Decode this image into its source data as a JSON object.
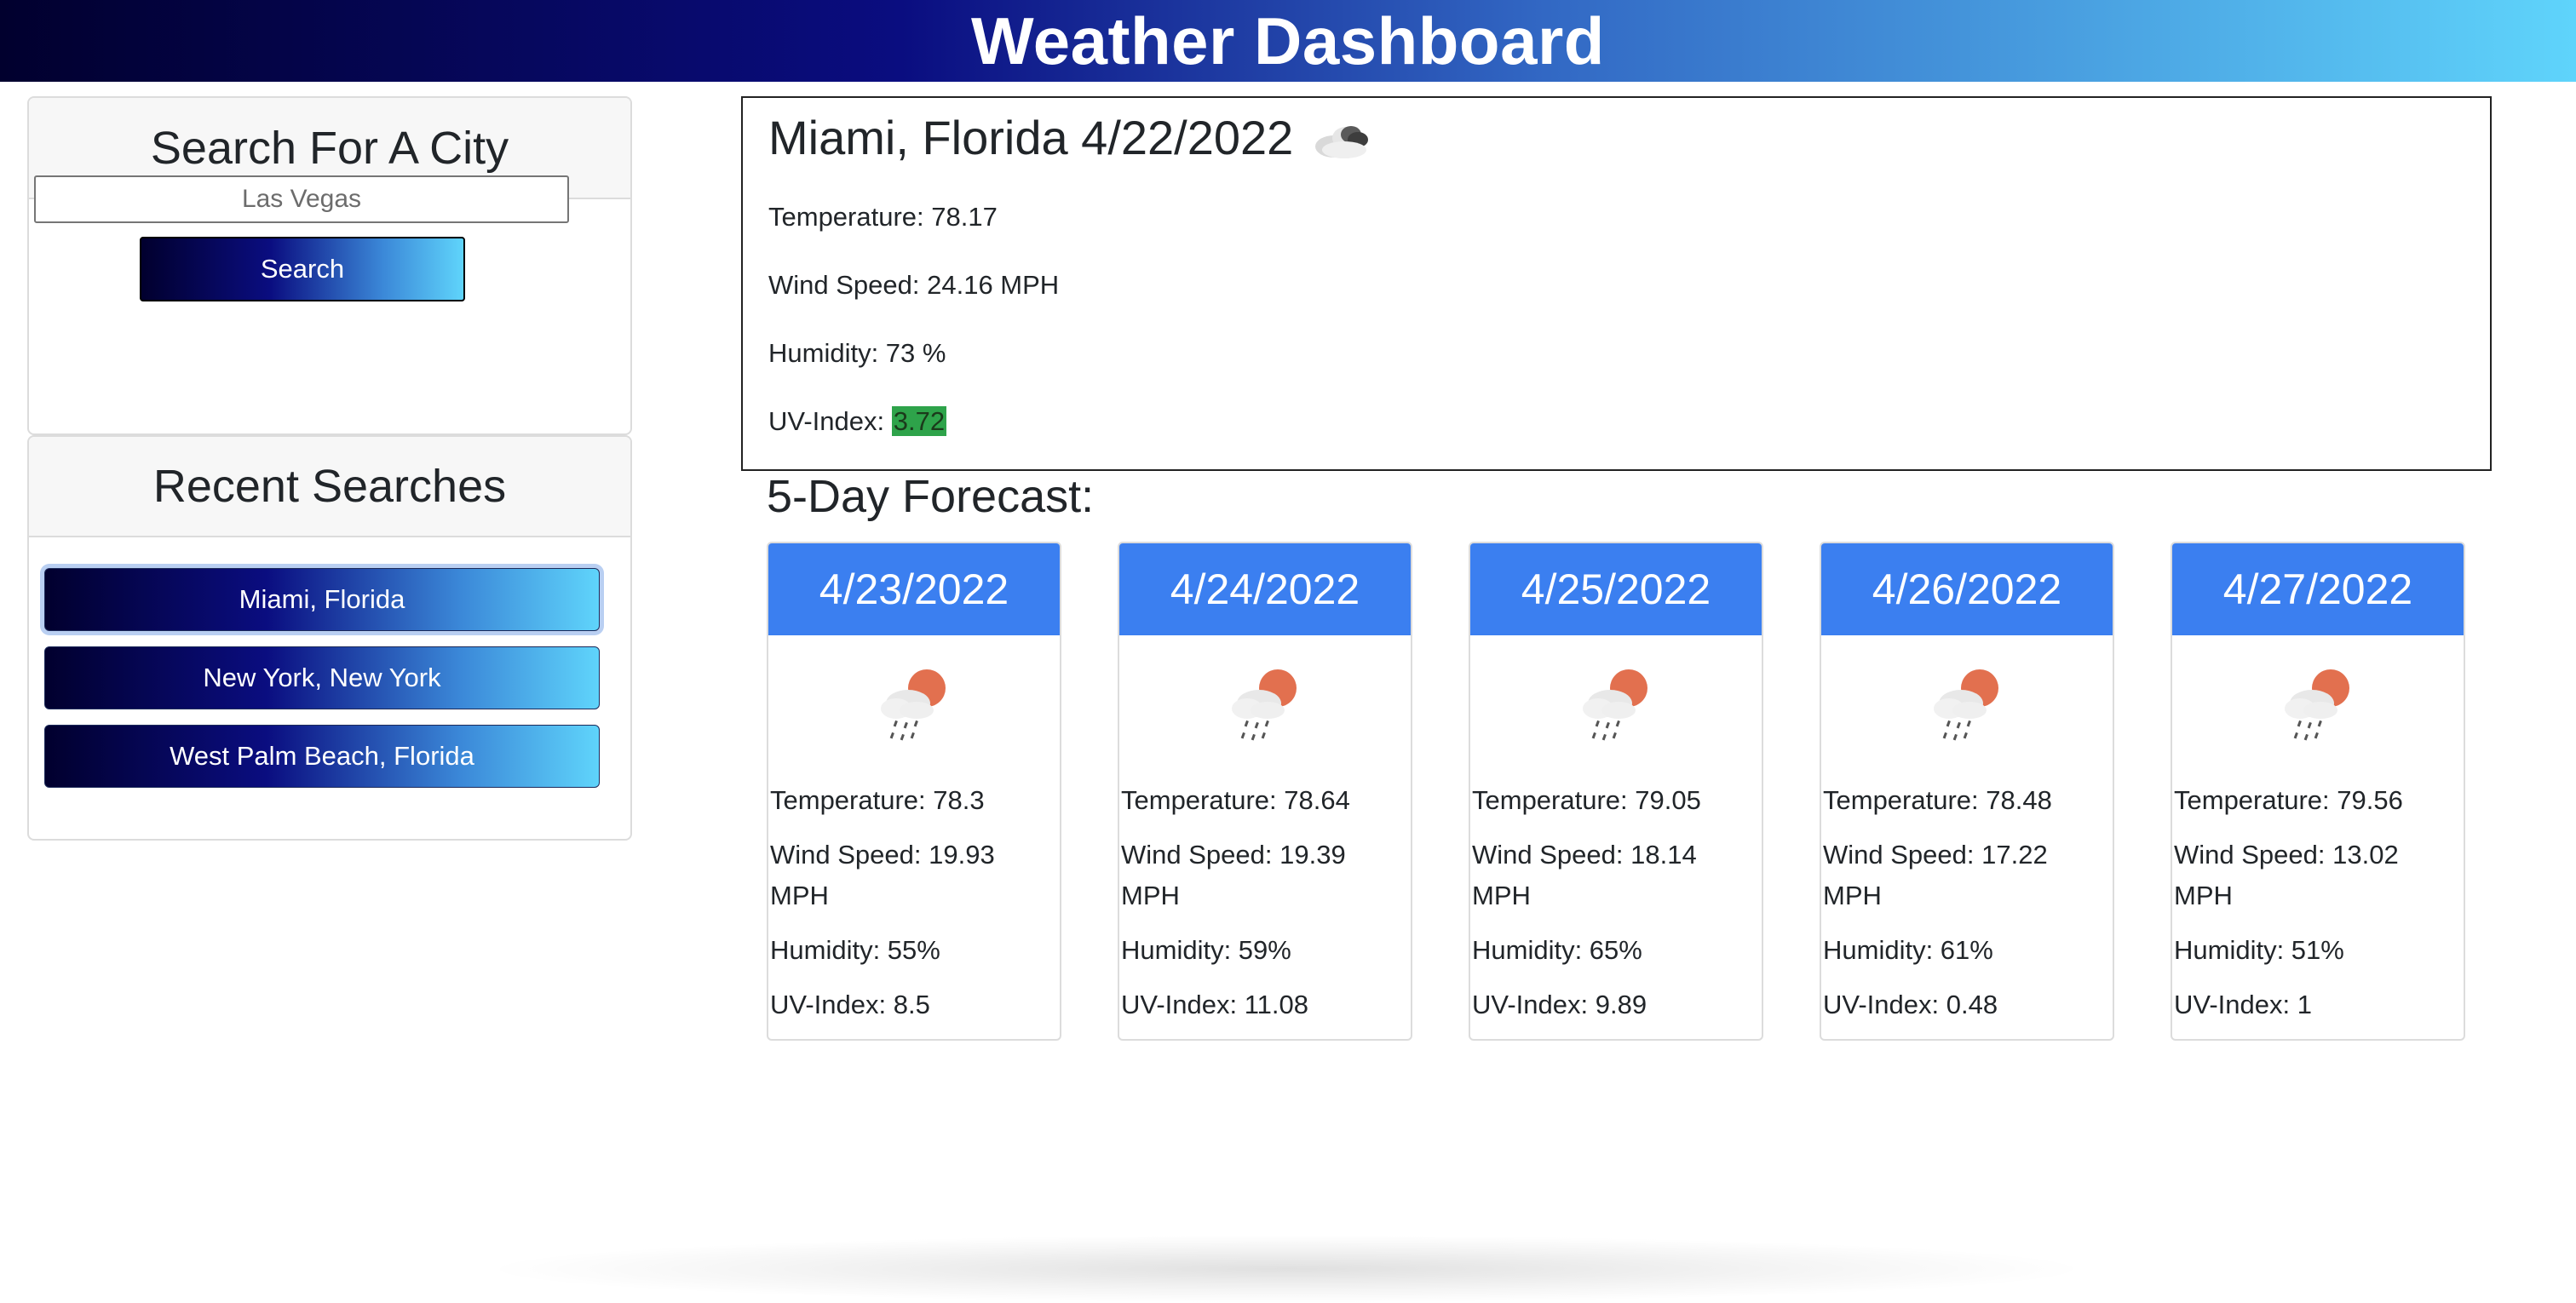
{
  "header": {
    "title": "Weather Dashboard"
  },
  "search": {
    "heading": "Search For A City",
    "placeholder": "Las Vegas",
    "button_label": "Search"
  },
  "recent": {
    "heading": "Recent Searches",
    "items": [
      {
        "label": "Miami, Florida"
      },
      {
        "label": "New York, New York"
      },
      {
        "label": "West Palm Beach, Florida"
      }
    ]
  },
  "current": {
    "title": "Miami, Florida 4/22/2022",
    "icon": "broken-clouds-icon",
    "temperature": "Temperature: 78.17",
    "wind": "Wind Speed: 24.16 MPH",
    "humidity": "Humidity: 73 %",
    "uv_label": "UV-Index: ",
    "uv_value": "3.72",
    "uv_color": "#2ea34a"
  },
  "forecast": {
    "heading": "5-Day Forecast:",
    "days": [
      {
        "date": "4/23/2022",
        "icon": "rain-sun-icon",
        "temperature": "Temperature: 78.3",
        "wind": "Wind Speed: 19.93 MPH",
        "humidity": "Humidity: 55%",
        "uv": "UV-Index: 8.5"
      },
      {
        "date": "4/24/2022",
        "icon": "rain-sun-icon",
        "temperature": "Temperature: 78.64",
        "wind": "Wind Speed: 19.39 MPH",
        "humidity": "Humidity: 59%",
        "uv": "UV-Index: 11.08"
      },
      {
        "date": "4/25/2022",
        "icon": "rain-sun-icon",
        "temperature": "Temperature: 79.05",
        "wind": "Wind Speed: 18.14 MPH",
        "humidity": "Humidity: 65%",
        "uv": "UV-Index: 9.89"
      },
      {
        "date": "4/26/2022",
        "icon": "rain-sun-icon",
        "temperature": "Temperature: 78.48",
        "wind": "Wind Speed: 17.22 MPH",
        "humidity": "Humidity: 61%",
        "uv": "UV-Index: 0.48"
      },
      {
        "date": "4/27/2022",
        "icon": "rain-sun-icon",
        "temperature": "Temperature: 79.56",
        "wind": "Wind Speed: 13.02 MPH",
        "humidity": "Humidity: 51%",
        "uv": "UV-Index: 1"
      }
    ]
  },
  "colors": {
    "forecast_header": "#3b7ff0",
    "uv_moderate": "#2ea34a"
  }
}
